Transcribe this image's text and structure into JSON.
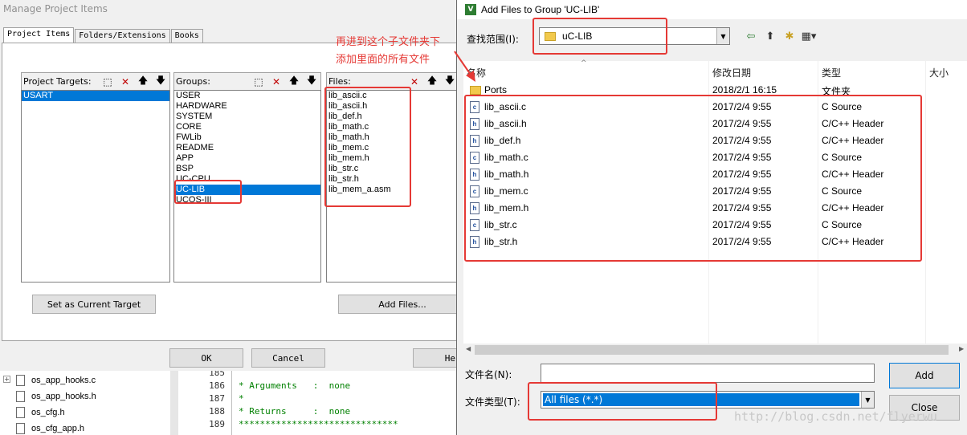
{
  "manage_dialog": {
    "title": "Manage Project Items",
    "tabs": [
      "Project Items",
      "Folders/Extensions",
      "Books"
    ],
    "targets_label": "Project Targets:",
    "targets": [
      "USART"
    ],
    "groups_label": "Groups:",
    "groups": [
      "USER",
      "HARDWARE",
      "SYSTEM",
      "CORE",
      "FWLib",
      "README",
      "APP",
      "BSP",
      "UC-CPU",
      "UC-LIB",
      "UCOS-III"
    ],
    "selected_group": "UC-LIB",
    "files_label": "Files:",
    "files": [
      "lib_ascii.c",
      "lib_ascii.h",
      "lib_def.h",
      "lib_math.c",
      "lib_math.h",
      "lib_mem.c",
      "lib_mem.h",
      "lib_str.c",
      "lib_str.h",
      "lib_mem_a.asm"
    ],
    "set_current_target": "Set as Current Target",
    "add_files": "Add Files...",
    "ok": "OK",
    "cancel": "Cancel",
    "help": "He"
  },
  "editor": {
    "tree_items": [
      "os_app_hooks.c",
      "os_app_hooks.h",
      "os_cfg.h",
      "os_cfg_app.h"
    ],
    "line_numbers": [
      "185",
      "186",
      "187",
      "188",
      "189"
    ],
    "code_lines": [
      "",
      "* Arguments   :  none",
      "*",
      "* Returns     :  none",
      "******************************"
    ]
  },
  "add_dialog": {
    "title": "Add Files to Group 'UC-LIB'",
    "app_icon_letter": "V",
    "look_in_label": "查找范围(I):",
    "look_in_value": "uC-LIB",
    "columns": {
      "name": "名称",
      "date": "修改日期",
      "type": "类型",
      "size": "大小"
    },
    "rows": [
      {
        "name": "Ports",
        "date": "2018/2/1 16:15",
        "type": "文件夹",
        "icon": "folder-icon",
        "glyph": ""
      },
      {
        "name": "lib_ascii.c",
        "date": "2017/2/4 9:55",
        "type": "C Source",
        "icon": "c-file-icon",
        "glyph": "c"
      },
      {
        "name": "lib_ascii.h",
        "date": "2017/2/4 9:55",
        "type": "C/C++ Header",
        "icon": "h-file-icon",
        "glyph": "h"
      },
      {
        "name": "lib_def.h",
        "date": "2017/2/4 9:55",
        "type": "C/C++ Header",
        "icon": "h-file-icon",
        "glyph": "h"
      },
      {
        "name": "lib_math.c",
        "date": "2017/2/4 9:55",
        "type": "C Source",
        "icon": "c-file-icon",
        "glyph": "c"
      },
      {
        "name": "lib_math.h",
        "date": "2017/2/4 9:55",
        "type": "C/C++ Header",
        "icon": "h-file-icon",
        "glyph": "h"
      },
      {
        "name": "lib_mem.c",
        "date": "2017/2/4 9:55",
        "type": "C Source",
        "icon": "c-file-icon",
        "glyph": "c"
      },
      {
        "name": "lib_mem.h",
        "date": "2017/2/4 9:55",
        "type": "C/C++ Header",
        "icon": "h-file-icon",
        "glyph": "h"
      },
      {
        "name": "lib_str.c",
        "date": "2017/2/4 9:55",
        "type": "C Source",
        "icon": "c-file-icon",
        "glyph": "c"
      },
      {
        "name": "lib_str.h",
        "date": "2017/2/4 9:55",
        "type": "C/C++ Header",
        "icon": "h-file-icon",
        "glyph": "h"
      }
    ],
    "file_name_label": "文件名(N):",
    "file_name_value": "",
    "file_type_label": "文件类型(T):",
    "file_type_value": "All files (*.*)",
    "add_button": "Add",
    "close_button": "Close"
  },
  "annotation": {
    "line1": "再进到这个子文件夹下",
    "line2": "添加里面的所有文件",
    "color": "#e53935"
  },
  "watermark": "http://blog.csdn.net/flyerwu",
  "colors": {
    "selection": "#0078d7",
    "annotation": "#e53935"
  }
}
